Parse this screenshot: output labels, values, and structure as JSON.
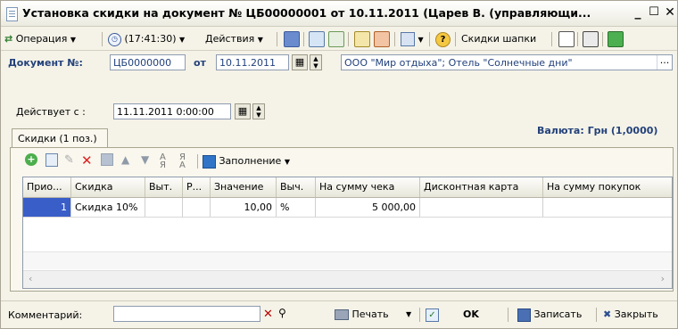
{
  "window": {
    "title": "Установка скидки на документ № ЦБ00000001 от 10.11.2011 (Царев В. (управляющи...",
    "minimize": "_",
    "maximize": "☐",
    "close": "✕"
  },
  "toolbar": {
    "operation": "Операция",
    "time": "(17:41:30)",
    "actions": "Действия",
    "header_discounts": "Скидки шапки",
    "help": "?"
  },
  "document": {
    "number_label": "Документ №:",
    "number_value": "ЦБ0000000",
    "from_label": "от",
    "date_value": "10.11.2011",
    "org_value": "ООО \"Мир отдыха\"; Отель \"Солнечные дни\"",
    "more": "..."
  },
  "valid_from": {
    "label": "Действует с :",
    "value": "11.11.2011 0:00:00"
  },
  "currency": "Валюта: Грн (1,0000)",
  "tab_label": "Скидки (1 поз.)",
  "inner_toolbar": {
    "fill": "Заполнение"
  },
  "table": {
    "columns": [
      "Прио...",
      "Скидка",
      "Выт.",
      "Р...",
      "Значение",
      "Выч.",
      "На сумму чека",
      "Дисконтная карта",
      "На сумму покупок"
    ],
    "rows": [
      {
        "priority": "1",
        "discount": "Скидка 10%",
        "vyt": "",
        "r": "",
        "value": "10,00",
        "calc": "%",
        "check_sum": "5 000,00",
        "card": "",
        "purchase_sum": ""
      }
    ]
  },
  "footer": {
    "comment_label": "Комментарий:",
    "comment_value": "",
    "print": "Печать",
    "ok": "OK",
    "save": "Записать",
    "close": "Закрыть"
  },
  "colors": {
    "accent_blue": "#23417a",
    "selected_cell": "#3a5ec8",
    "window_bg": "#f5f3e8"
  }
}
